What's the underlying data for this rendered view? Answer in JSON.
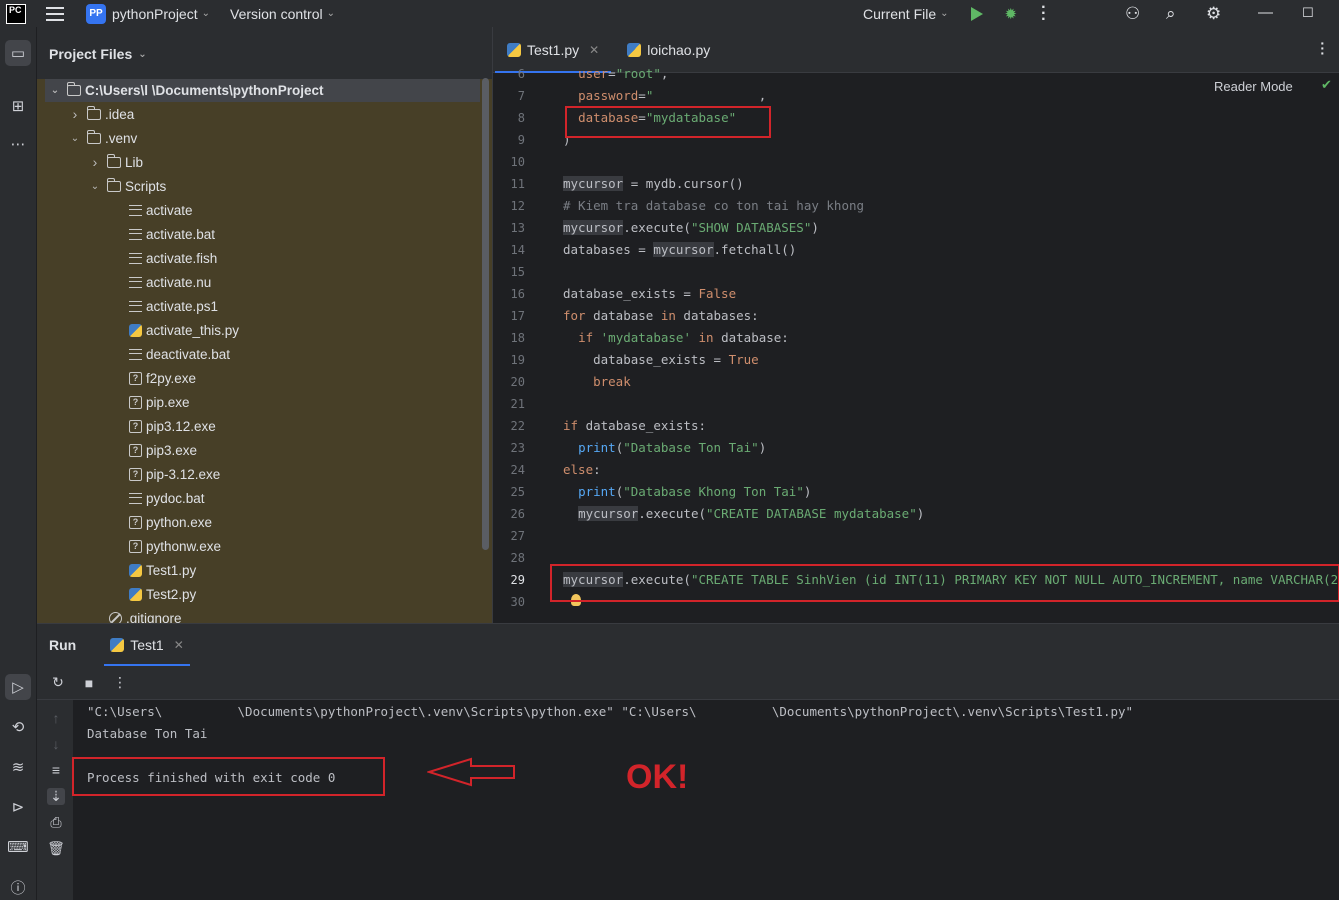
{
  "titlebar": {
    "logo": "PC",
    "project_badge": "PP",
    "project_name": "pythonProject",
    "version_control": "Version control",
    "run_config": "Current File"
  },
  "project_panel": {
    "title": "Project Files",
    "items": [
      {
        "label": "C:\\Users\\l                 \\Documents\\pythonProject",
        "type": "folder",
        "depth": 0,
        "expanded": true,
        "selected": true
      },
      {
        "label": ".idea",
        "type": "folder",
        "depth": 1,
        "expanded": false
      },
      {
        "label": ".venv",
        "type": "folder",
        "depth": 1,
        "expanded": true
      },
      {
        "label": "Lib",
        "type": "folder",
        "depth": 2,
        "expanded": false
      },
      {
        "label": "Scripts",
        "type": "folder",
        "depth": 2,
        "expanded": true
      },
      {
        "label": "activate",
        "type": "text",
        "depth": 3
      },
      {
        "label": "activate.bat",
        "type": "text",
        "depth": 3
      },
      {
        "label": "activate.fish",
        "type": "text",
        "depth": 3
      },
      {
        "label": "activate.nu",
        "type": "text",
        "depth": 3
      },
      {
        "label": "activate.ps1",
        "type": "text",
        "depth": 3
      },
      {
        "label": "activate_this.py",
        "type": "python",
        "depth": 3
      },
      {
        "label": "deactivate.bat",
        "type": "text",
        "depth": 3
      },
      {
        "label": "f2py.exe",
        "type": "unknown",
        "depth": 3
      },
      {
        "label": "pip.exe",
        "type": "unknown",
        "depth": 3
      },
      {
        "label": "pip3.12.exe",
        "type": "unknown",
        "depth": 3
      },
      {
        "label": "pip3.exe",
        "type": "unknown",
        "depth": 3
      },
      {
        "label": "pip-3.12.exe",
        "type": "unknown",
        "depth": 3
      },
      {
        "label": "pydoc.bat",
        "type": "text",
        "depth": 3
      },
      {
        "label": "python.exe",
        "type": "unknown",
        "depth": 3
      },
      {
        "label": "pythonw.exe",
        "type": "unknown",
        "depth": 3
      },
      {
        "label": "Test1.py",
        "type": "python",
        "depth": 3
      },
      {
        "label": "Test2.py",
        "type": "python",
        "depth": 3
      },
      {
        "label": ".gitignore",
        "type": "ignore",
        "depth": 2
      }
    ]
  },
  "editor": {
    "tabs": [
      {
        "label": "Test1.py",
        "active": true,
        "closable": true
      },
      {
        "label": "loichao.py",
        "active": false,
        "closable": false
      }
    ],
    "reader_mode": "Reader Mode",
    "line_numbers": [
      "6",
      "7",
      "8",
      "9",
      "10",
      "11",
      "12",
      "13",
      "14",
      "15",
      "16",
      "17",
      "18",
      "19",
      "20",
      "21",
      "22",
      "23",
      "24",
      "25",
      "26",
      "27",
      "28",
      "29",
      "30"
    ]
  },
  "run_panel": {
    "title": "Run",
    "tab_label": "Test1",
    "console_lines": [
      "\"C:\\Users\\          \\Documents\\pythonProject\\.venv\\Scripts\\python.exe\" \"C:\\Users\\          \\Documents\\pythonProject\\.venv\\Scripts\\Test1.py\"",
      "Database Ton Tai",
      "",
      "Process finished with exit code 0"
    ],
    "annotation": "OK!"
  },
  "colors": {
    "annotation_red": "#d2242a",
    "accent_blue": "#3574f0",
    "run_green": "#5fb865"
  }
}
